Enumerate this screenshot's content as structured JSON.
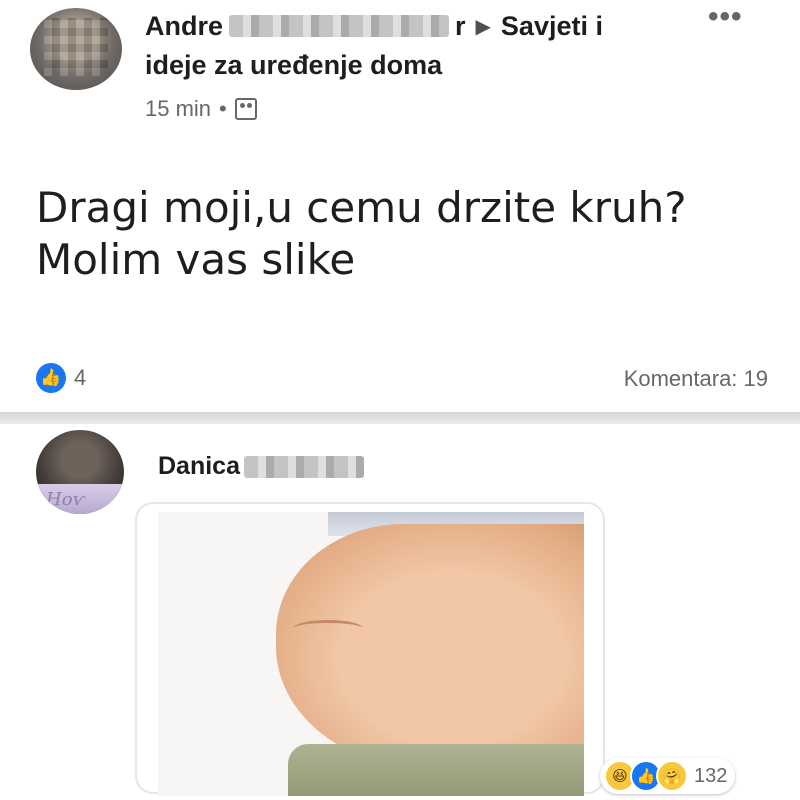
{
  "post": {
    "author_visible": "Andre",
    "author_suffix": "r",
    "group_name_line1": "Savjeti i",
    "group_name_line2": "ideje za uređenje doma",
    "time": "15 min",
    "separator": "•",
    "audience_icon": "group-icon",
    "more_label": "•••",
    "text_line1": "Dragi moji,u cemu drzite kruh?",
    "text_line2": "Molim vas slike",
    "likes_count": "4",
    "comments_label": "Komentara: 19"
  },
  "comment": {
    "author_visible": "Danica",
    "avatar_text": "Ноѵ",
    "reactions": [
      "haha",
      "like",
      "care"
    ],
    "reactions_count": "132"
  },
  "colors": {
    "primary_text": "#1c1e21",
    "secondary_text": "#65676b",
    "like_blue": "#1877f2"
  }
}
